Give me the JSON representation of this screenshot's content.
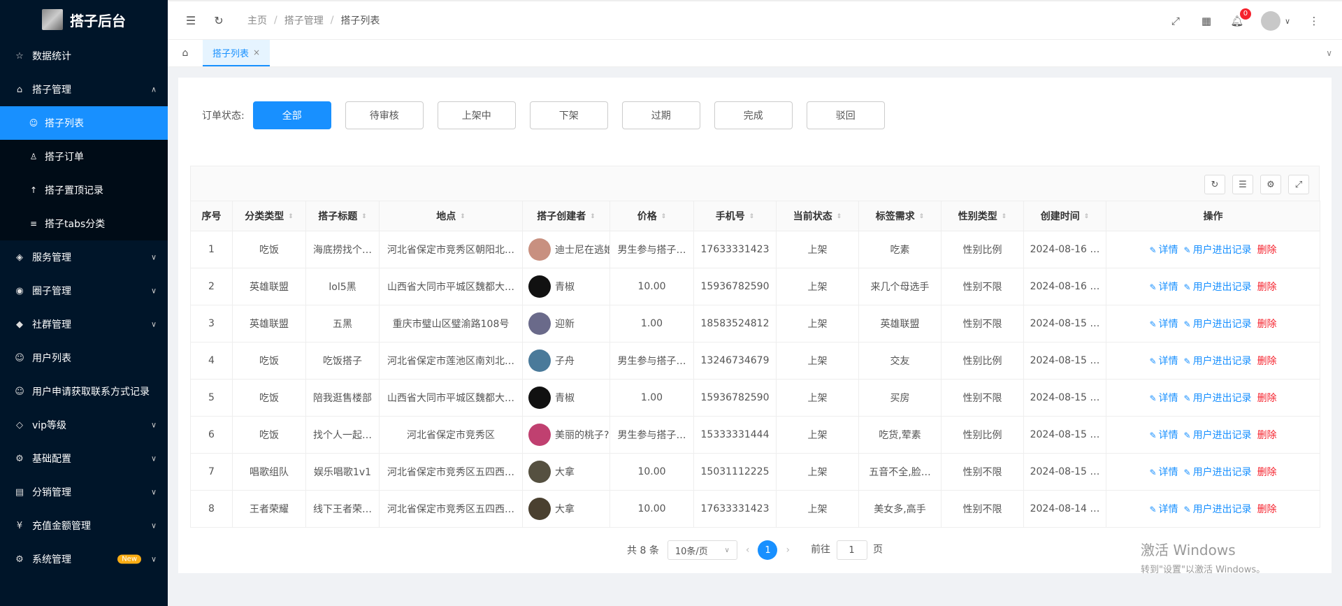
{
  "app": {
    "title": "搭子后台"
  },
  "sidebar": {
    "items": [
      {
        "label": "数据统计",
        "icon": "star-icon",
        "glyph": "☆"
      },
      {
        "label": "搭子管理",
        "icon": "shop-icon",
        "glyph": "⌂",
        "expanded": true,
        "children": [
          {
            "label": "搭子列表",
            "icon": "users-icon",
            "glyph": "☺",
            "active": true
          },
          {
            "label": "搭子订单",
            "icon": "user-icon",
            "glyph": "♙"
          },
          {
            "label": "搭子置顶记录",
            "icon": "pin-icon",
            "glyph": "↑"
          },
          {
            "label": "搭子tabs分类",
            "icon": "list-icon",
            "glyph": "≡"
          }
        ]
      },
      {
        "label": "服务管理",
        "icon": "cube-icon",
        "glyph": "◈",
        "collapsed": true
      },
      {
        "label": "圈子管理",
        "icon": "palette-icon",
        "glyph": "◉",
        "collapsed": true
      },
      {
        "label": "社群管理",
        "icon": "graduation-icon",
        "glyph": "◆",
        "collapsed": true
      },
      {
        "label": "用户列表",
        "icon": "user-group-icon",
        "glyph": "☺"
      },
      {
        "label": "用户申请获取联系方式记录",
        "icon": "user-group-icon",
        "glyph": "☺"
      },
      {
        "label": "vip等级",
        "icon": "layers-icon",
        "glyph": "◇",
        "collapsed": true
      },
      {
        "label": "基础配置",
        "icon": "api-icon",
        "glyph": "⚙",
        "collapsed": true
      },
      {
        "label": "分销管理",
        "icon": "document-icon",
        "glyph": "▤",
        "collapsed": true
      },
      {
        "label": "充值金额管理",
        "icon": "yen-icon",
        "glyph": "¥",
        "collapsed": true
      },
      {
        "label": "系统管理",
        "icon": "gear-icon",
        "glyph": "⚙",
        "badge": "New",
        "collapsed": true
      }
    ]
  },
  "header": {
    "breadcrumb": [
      "主页",
      "搭子管理",
      "搭子列表"
    ],
    "notification_count": "0"
  },
  "tabs": [
    {
      "label": "搭子列表"
    }
  ],
  "filter": {
    "label": "订单状态:",
    "options": [
      "全部",
      "待审核",
      "上架中",
      "下架",
      "过期",
      "完成",
      "驳回"
    ],
    "selected": "全部"
  },
  "table": {
    "columns": [
      "序号",
      "分类类型",
      "搭子标题",
      "地点",
      "搭子创建者",
      "价格",
      "手机号",
      "当前状态",
      "标签需求",
      "性别类型",
      "创建时间",
      "操作"
    ],
    "rows": [
      [
        "1",
        "吃饭",
        "海底捞找个…",
        "河北省保定市竞秀区朝阳北…",
        "迪士尼在逃娘",
        "男生参与搭子…",
        "17633331423",
        "上架",
        "吃素",
        "性别比例",
        "2024-08-16 …"
      ],
      [
        "2",
        "英雄联盟",
        "lol5黑",
        "山西省大同市平城区魏都大…",
        "青椒",
        "10.00",
        "15936782590",
        "上架",
        "来几个母选手",
        "性别不限",
        "2024-08-16 …"
      ],
      [
        "3",
        "英雄联盟",
        "五黑",
        "重庆市璧山区璧渝路108号",
        "迎新",
        "1.00",
        "18583524812",
        "上架",
        "英雄联盟",
        "性别不限",
        "2024-08-15 …"
      ],
      [
        "4",
        "吃饭",
        "吃饭搭子",
        "河北省保定市莲池区南刘北…",
        "子舟",
        "男生参与搭子…",
        "13246734679",
        "上架",
        "交友",
        "性别比例",
        "2024-08-15 …"
      ],
      [
        "5",
        "吃饭",
        "陪我逛售楼部",
        "山西省大同市平城区魏都大…",
        "青椒",
        "1.00",
        "15936782590",
        "上架",
        "买房",
        "性别不限",
        "2024-08-15 …"
      ],
      [
        "6",
        "吃饭",
        "找个人一起…",
        "河北省保定市竞秀区",
        "美丽的桃子?",
        "男生参与搭子…",
        "15333331444",
        "上架",
        "吃货,荤素",
        "性别比例",
        "2024-08-15 …"
      ],
      [
        "7",
        "唱歌组队",
        "娱乐唱歌1v1",
        "河北省保定市竞秀区五四西…",
        "大拿",
        "10.00",
        "15031112225",
        "上架",
        "五音不全,脸…",
        "性别不限",
        "2024-08-15 …"
      ],
      [
        "8",
        "王者荣耀",
        "线下王者荣…",
        "河北省保定市竞秀区五四西…",
        "大拿",
        "10.00",
        "17633331423",
        "上架",
        "美女多,高手",
        "性别不限",
        "2024-08-14 …"
      ]
    ],
    "avatar_colors": [
      "#c89080",
      "#111111",
      "#6a6a8a",
      "#4a7a9a",
      "#111111",
      "#c04070",
      "#555040",
      "#4a4030"
    ],
    "actions": {
      "detail": "详情",
      "records": "用户进出记录",
      "delete": "删除"
    }
  },
  "pagination": {
    "total": "共 8 条",
    "page_size": "10条/页",
    "current": "1",
    "goto_prefix": "前往",
    "goto_value": "1",
    "goto_suffix": "页"
  },
  "watermark": {
    "line1": "激活 Windows",
    "line2": "转到\"设置\"以激活 Windows。"
  }
}
